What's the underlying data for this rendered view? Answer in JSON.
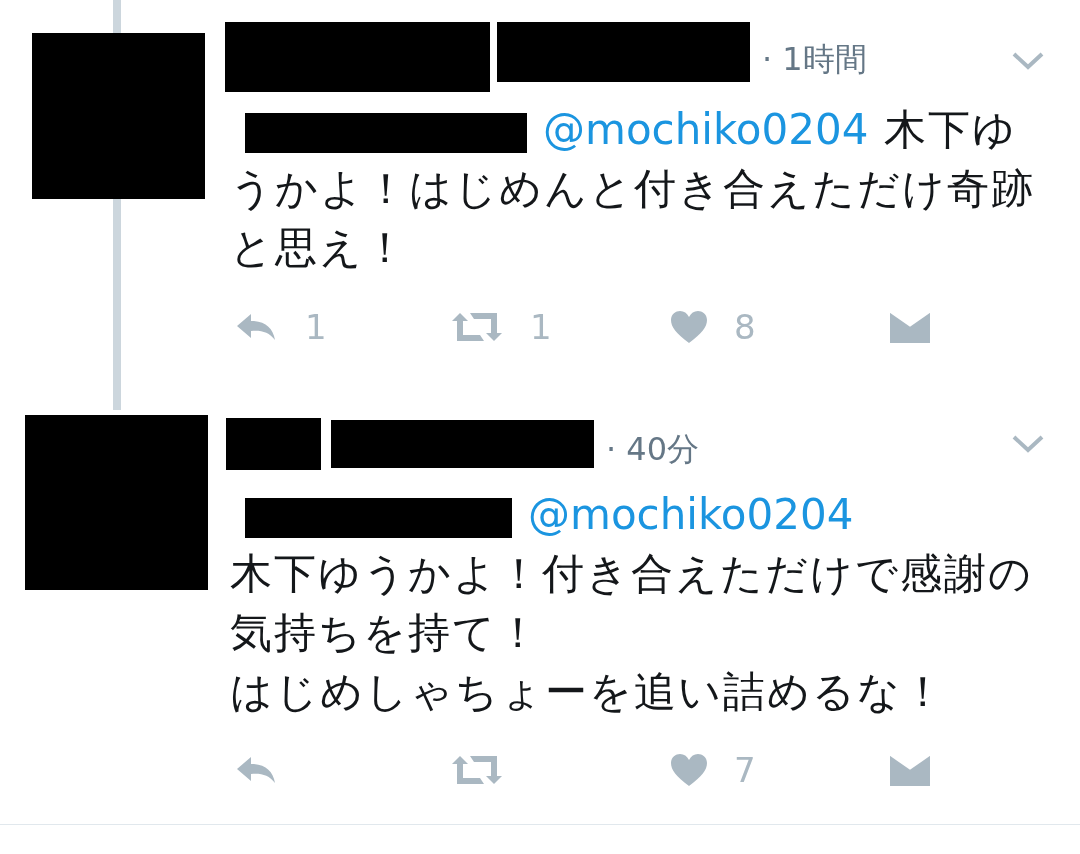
{
  "tweets": [
    {
      "time": "· 1時間",
      "mention": "@mochiko0204",
      "text_on_mention_line": true,
      "text": [
        "木下ゆうかよ！はじめんと付き合えただけ奇跡と思え！"
      ],
      "thread_line": true,
      "reply_count": "1",
      "retweet_count": "1",
      "like_count": "8"
    },
    {
      "time": "· 40分",
      "mention": "@mochiko0204",
      "text_on_mention_line": false,
      "text": [
        "木下ゆうかよ！付き合えただけで感謝の気持ちを持て！",
        "はじめしゃちょーを追い詰めるな！"
      ],
      "thread_line": false,
      "like_count": "7"
    }
  ]
}
